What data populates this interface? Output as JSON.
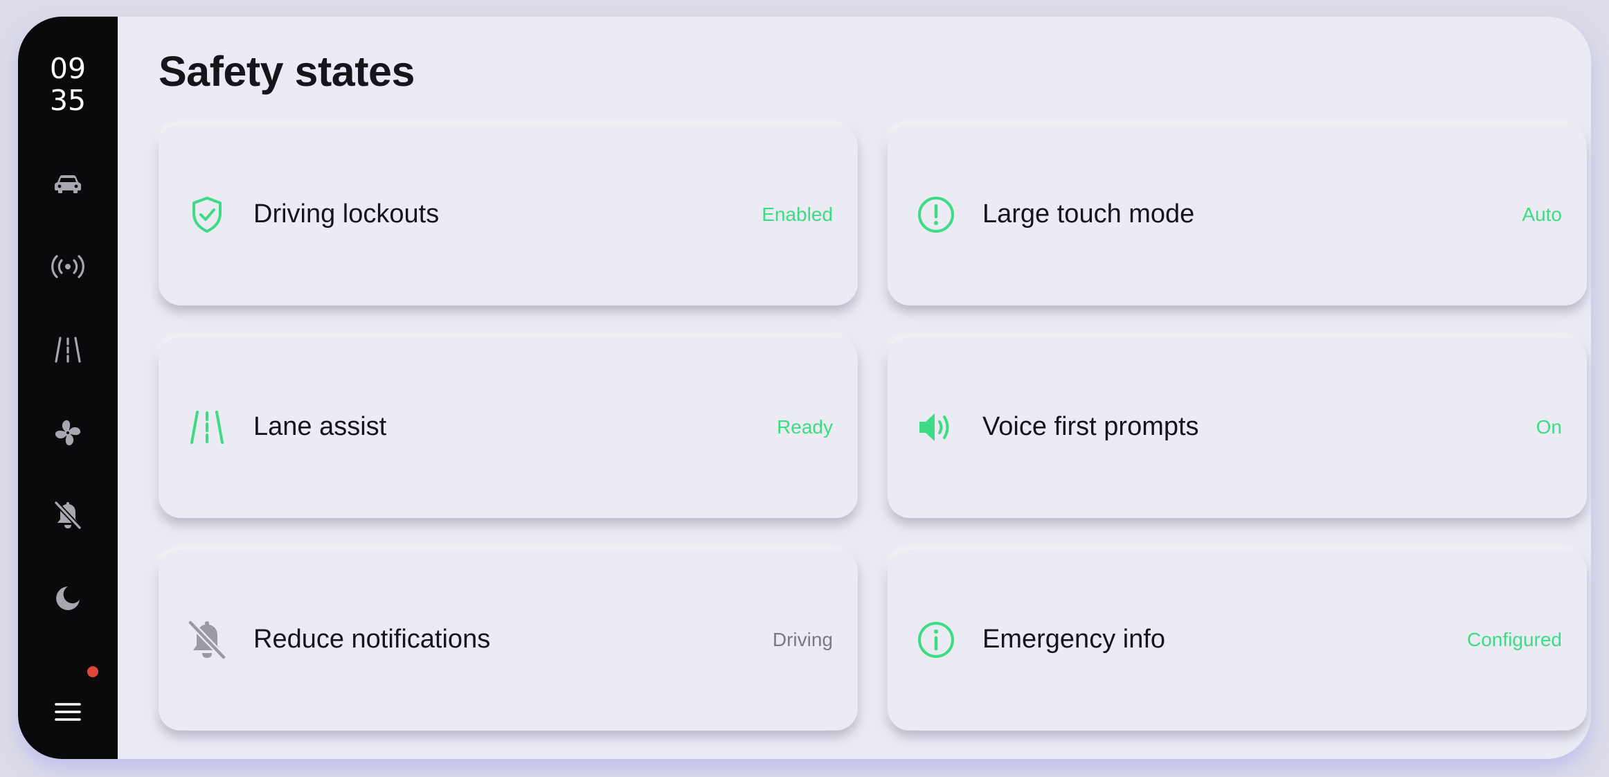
{
  "clock": {
    "hours": "09",
    "minutes": "35"
  },
  "header": {
    "title": "Safety states"
  },
  "rail": {
    "items": [
      {
        "icon": "car-icon"
      },
      {
        "icon": "broadcast-icon"
      },
      {
        "icon": "lane-icon"
      },
      {
        "icon": "fan-icon"
      },
      {
        "icon": "bell-off-icon"
      },
      {
        "icon": "moon-icon"
      },
      {
        "icon": "menu-icon",
        "badge": true
      }
    ]
  },
  "cards": [
    {
      "label": "Driving lockouts",
      "status": "Enabled",
      "icon": "shield-check-icon",
      "status_tone": "green"
    },
    {
      "label": "Large touch mode",
      "status": "Auto",
      "icon": "alert-circle-icon",
      "status_tone": "green"
    },
    {
      "label": "Lane assist",
      "status": "Ready",
      "icon": "lane-icon",
      "status_tone": "green"
    },
    {
      "label": "Voice first prompts",
      "status": "On",
      "icon": "speaker-icon",
      "status_tone": "green"
    },
    {
      "label": "Reduce notifications",
      "status": "Driving",
      "icon": "bell-off-icon",
      "status_tone": "gray"
    },
    {
      "label": "Emergency info",
      "status": "Configured",
      "icon": "info-circle-icon",
      "status_tone": "green"
    }
  ],
  "colors": {
    "accent": "#3ddc84",
    "muted_status": "#7a7a84",
    "rail_background": "#0a0a0c",
    "badge": "#e0463c",
    "background": "#ebebf3"
  }
}
